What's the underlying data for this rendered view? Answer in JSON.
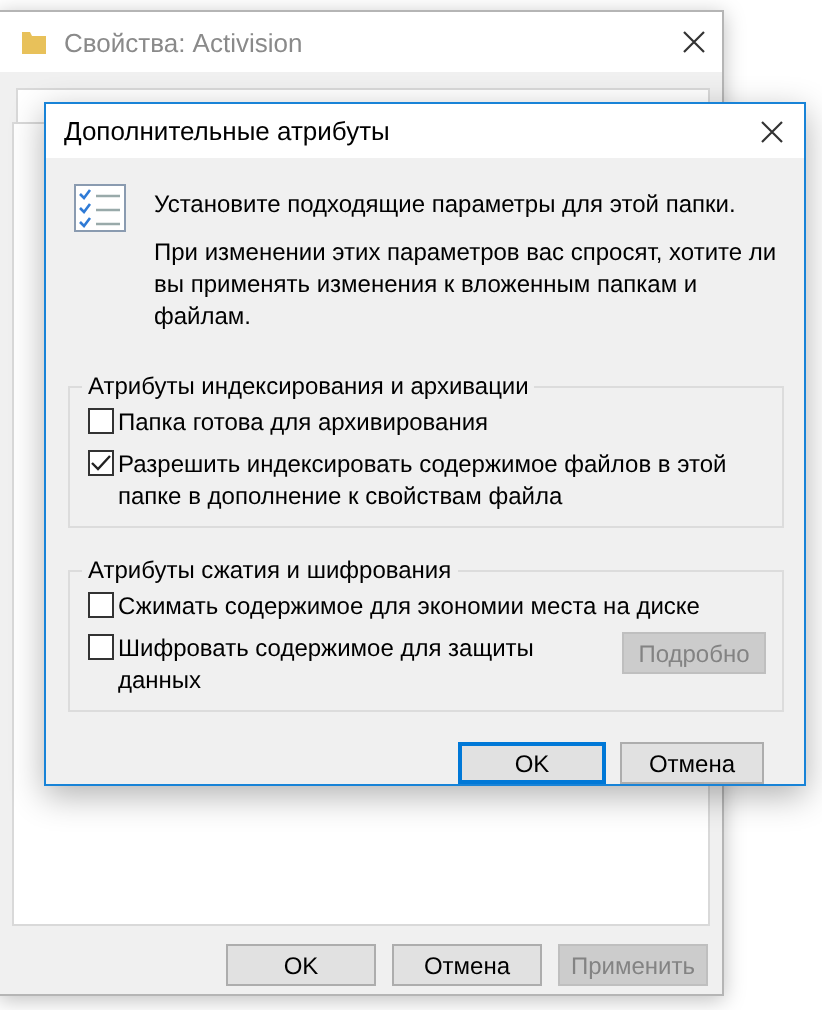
{
  "background_window": {
    "title": "Свойства: Activision",
    "buttons": [
      {
        "label": "OK",
        "disabled": false
      },
      {
        "label": "Отмена",
        "disabled": false
      },
      {
        "label": "Применить",
        "disabled": true
      }
    ]
  },
  "dialog": {
    "title": "Дополнительные атрибуты",
    "intro": "Установите подходящие параметры для этой папки.",
    "note": "При изменении этих параметров вас спросят, хотите ли вы применять изменения к вложенным папкам и файлам.",
    "groups": [
      {
        "legend": "Атрибуты индексирования и архивации",
        "options": [
          {
            "label": "Папка готова для архивирования",
            "checked": false
          },
          {
            "label": "Разрешить индексировать содержимое файлов в этой папке в дополнение к свойствам файла",
            "checked": true
          }
        ]
      },
      {
        "legend": "Атрибуты сжатия и шифрования",
        "options": [
          {
            "label": "Сжимать содержимое для экономии места на диске",
            "checked": false
          },
          {
            "label": "Шифровать содержимое для защиты данных",
            "checked": false,
            "action": {
              "label": "Подробно",
              "disabled": true
            }
          }
        ]
      }
    ],
    "buttons": [
      {
        "label": "OK",
        "default": true
      },
      {
        "label": "Отмена",
        "default": false
      }
    ]
  }
}
